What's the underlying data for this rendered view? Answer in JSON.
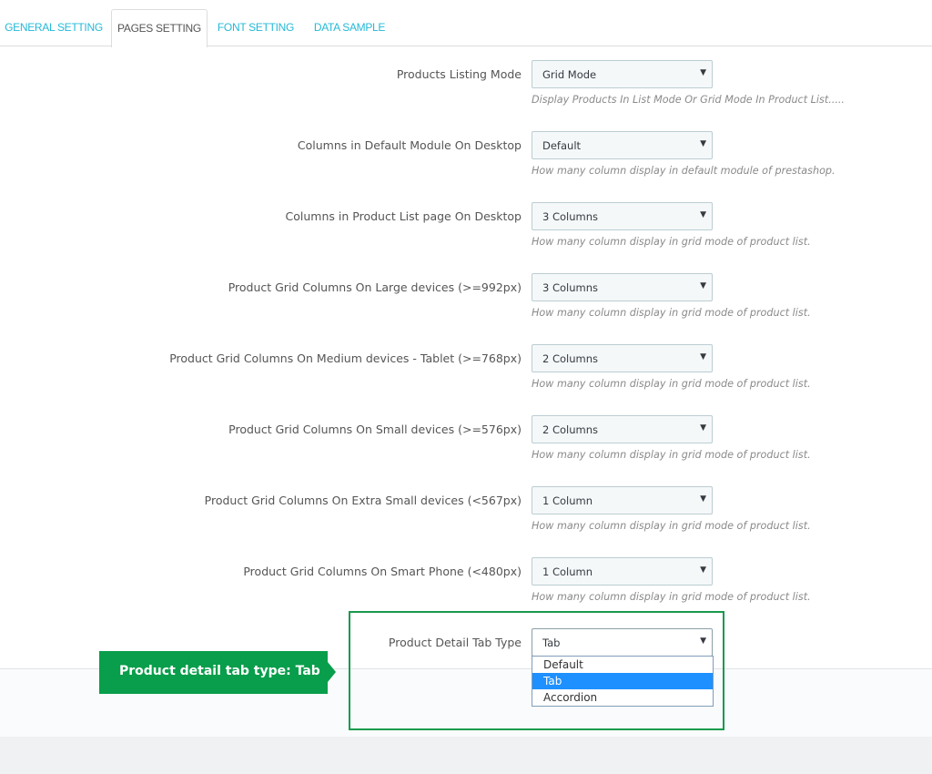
{
  "tabs": [
    {
      "label": "GENERAL SETTING",
      "active": false
    },
    {
      "label": "PAGES SETTING",
      "active": true
    },
    {
      "label": "FONT SETTING",
      "active": false
    },
    {
      "label": "DATA SAMPLE",
      "active": false
    }
  ],
  "rows": [
    {
      "label": "Products Listing Mode",
      "value": "Grid Mode",
      "help": "Display Products In List Mode Or Grid Mode In Product List....."
    },
    {
      "label": "Columns in Default Module On Desktop",
      "value": "Default",
      "help": "How many column display in default module of prestashop."
    },
    {
      "label": "Columns in Product List page On Desktop",
      "value": "3 Columns",
      "help": "How many column display in grid mode of product list."
    },
    {
      "label": "Product Grid Columns On Large devices (>=992px)",
      "value": "3 Columns",
      "help": "How many column display in grid mode of product list."
    },
    {
      "label": "Product Grid Columns On Medium devices - Tablet (>=768px)",
      "value": "2 Columns",
      "help": "How many column display in grid mode of product list."
    },
    {
      "label": "Product Grid Columns On Small devices (>=576px)",
      "value": "2 Columns",
      "help": "How many column display in grid mode of product list."
    },
    {
      "label": "Product Grid Columns On Extra Small devices (<567px)",
      "value": "1 Column",
      "help": "How many column display in grid mode of product list."
    },
    {
      "label": "Product Grid Columns On Smart Phone (<480px)",
      "value": "1 Column",
      "help": "How many column display in grid mode of product list."
    }
  ],
  "detail_tab": {
    "label": "Product Detail Tab Type",
    "value": "Tab",
    "options": [
      "Default",
      "Tab",
      "Accordion"
    ],
    "selected": "Tab"
  },
  "callout": {
    "text": "Product detail tab type: Tab"
  },
  "icons": {
    "select_caret": "▼"
  },
  "colors": {
    "accent": "#25b9d7",
    "highlight": "#189a4d",
    "callout": "#089e4b",
    "option_selected": "#1e90ff"
  }
}
